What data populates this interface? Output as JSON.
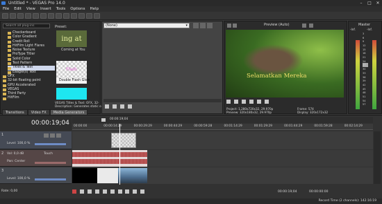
{
  "window": {
    "title": "Untitled * - VEGAS Pro 14.0",
    "minimize": "–",
    "maximize": "□",
    "close": "✕"
  },
  "menu": [
    "File",
    "Edit",
    "View",
    "Insert",
    "Tools",
    "Options",
    "Help"
  ],
  "explorer": {
    "search_placeholder": "Search all plug-ins",
    "preset_label": "Preset:",
    "items": [
      {
        "label": "Checkerboard",
        "selected": false
      },
      {
        "label": "Color Gradient",
        "selected": false
      },
      {
        "label": "Credit Roll",
        "selected": false
      },
      {
        "label": "HitFilm Light Flares",
        "selected": false
      },
      {
        "label": "Noise Texture",
        "selected": false
      },
      {
        "label": "ProType Titler",
        "selected": false
      },
      {
        "label": "Solid Color",
        "selected": false
      },
      {
        "label": "Test Pattern",
        "selected": false
      },
      {
        "label": "Titles & Text",
        "selected": true
      },
      {
        "label": "Eaagle(s) Text",
        "selected": false
      },
      {
        "label": "OFX",
        "selected": false
      },
      {
        "label": "32-bit floating point",
        "selected": false
      },
      {
        "label": "GPU Accelerated",
        "selected": false
      },
      {
        "label": "VEGAS",
        "selected": false
      },
      {
        "label": "Third Party",
        "selected": false
      },
      {
        "label": "HitFilm",
        "selected": false
      }
    ],
    "presets": [
      {
        "caption": "Coming at You",
        "thumb_text": "ing at"
      },
      {
        "caption": "Double Flash Glow",
        "thumb_text": "Flash"
      },
      {
        "caption": "",
        "thumb_text": ""
      }
    ],
    "plugin_name": "VEGAS Titles & Text: OFX, 32-",
    "description": "Description: Generates static o",
    "tabs": [
      "Transitions",
      "Video FX",
      "Media Generators"
    ]
  },
  "trimmer": {
    "dropdown_value": "(None)"
  },
  "preview": {
    "mode": "Preview (Auto)",
    "overlay_text": "Selamatkan Mereka",
    "project": "Project: 1,280x720x32, 29.970p",
    "preview_res": "Preview: 320x180x32, 29.970p",
    "frame": "Frame: 574",
    "display": "Display: 320x172x32"
  },
  "master": {
    "label": "Master",
    "levels": [
      "-Inf.",
      "-Inf."
    ],
    "scale": [
      "3",
      "6",
      "9",
      "12",
      "15",
      "18",
      "21",
      "24",
      "27",
      "30",
      "33",
      "36",
      "39",
      "42",
      "45",
      "48",
      "51",
      "54",
      "57"
    ]
  },
  "timeline": {
    "timecode": "00:00:19;04",
    "marker": "00:00:19;04",
    "ruler": [
      "00:00:00",
      "00:00:14:29",
      "00:00:29:29",
      "00:00:44:29",
      "00:00:59:28",
      "00:01:14:29",
      "00:01:29:29",
      "00:01:44:29",
      "00:01:59:28",
      "00:02:14:29"
    ],
    "tracks": [
      {
        "id": "1",
        "level": "Level: 100,0 %"
      },
      {
        "id": "2",
        "vol": "Vol: 0,0 dB",
        "pan": "Pan: Center",
        "touch": "Touch"
      },
      {
        "id": "3",
        "level": "Level: 100,0 %"
      }
    ],
    "rate": "Rate: 0,00",
    "current_time": "00:00:19;04",
    "end_time": "00:00:00:00",
    "record_time": "Record Time (2 channels): 142:16:19"
  },
  "colors": {
    "bg": "#3a3a3a",
    "panel": "#2b2b2b",
    "cyan": "#1ee6f0",
    "waveform": "#a83a3a"
  }
}
